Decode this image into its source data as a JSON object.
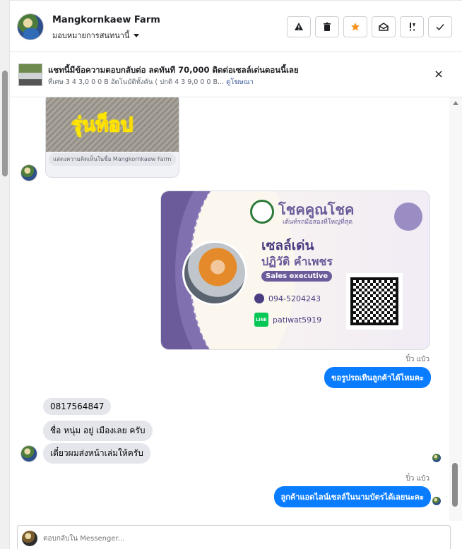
{
  "header": {
    "page_name": "Mangkornkaew Farm",
    "assign_label": "มอบหมายการสนทนานี้",
    "actions": [
      {
        "icon": "warning-icon"
      },
      {
        "icon": "trash-icon"
      },
      {
        "icon": "star-icon"
      },
      {
        "icon": "mail-open-icon"
      },
      {
        "icon": "spam-icon"
      },
      {
        "icon": "check-icon"
      }
    ],
    "star_color": "#f7931e"
  },
  "ad": {
    "title": "แชทนี้มีข้อความตอบกลับต่อ ลดทันที 70,000 ติดต่อเซลล์เด่นตอนนี้เลย",
    "subtitle": "ที่เศษ 3 4 3,0 0 0 B อัตโนมัติทั้งคัน ( ปกติ 4 3 9,0 0 0 B...",
    "link": "ดูโฆษณา"
  },
  "messages": {
    "card1_overlay": "รุ่นท็อป",
    "card1_caption": "แสดงความคิดเห็นในชื่อ Mangkornkaew Farm",
    "bizcard": {
      "brand": "โชคคูณโชค",
      "tagline": "เต้นท์รถมือสองที่ใหญ่ที่สุด",
      "title": "เซลล์เด่น",
      "name": "ปฏิวัติ คำเพชร",
      "role": "Sales executive",
      "phone": "094-5204243",
      "line_id": "patiwat5919",
      "line_badge": "LINE"
    },
    "ts1": "ปิ๋ว แป๋ว",
    "out1": "ขอรูปรถเทินลูกค้าได้ไหมคะ",
    "in1": "0817564847",
    "in2": "ชื่อ หนุ่ม อยู่ เมืองเลย ครับ",
    "in3": "เดี๋ยวผมส่งหน้าเล่มให้ครับ",
    "ts2": "ปิ๋ว แป๋ว",
    "out2": "ลูกค้าแอดไลน์เซลล์ในนามบัตรได้เลยนะคะ"
  },
  "compose": {
    "placeholder": "ตอบกลับใน Messenger..."
  },
  "colors": {
    "accent": "#0a7cff",
    "incoming_bubble": "#e4e6eb",
    "card_purple": "#6b5b9a"
  }
}
